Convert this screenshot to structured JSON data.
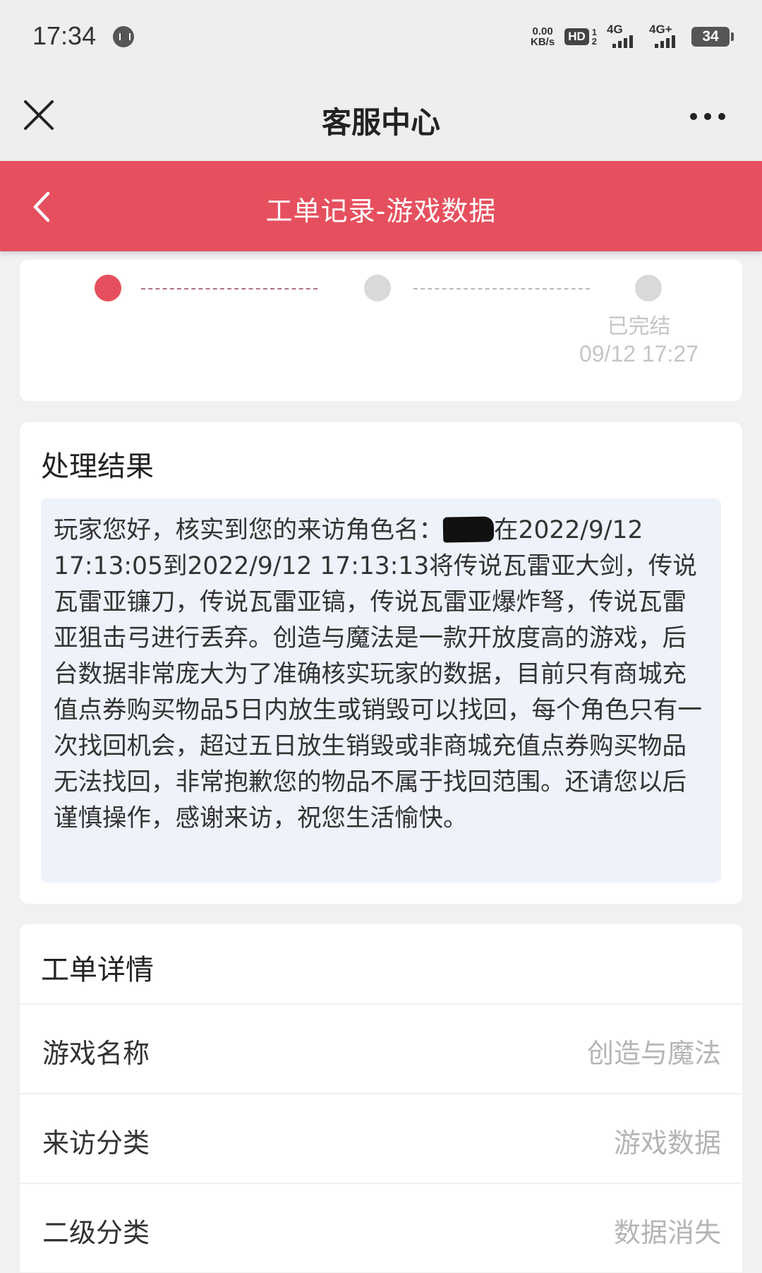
{
  "status_bar": {
    "time": "17:34",
    "net_speed_value": "0.00",
    "net_speed_unit": "KB/s",
    "hd_label": "HD",
    "hd_sub_top": "1",
    "hd_sub_bottom": "2",
    "signal1_label": "4G",
    "signal2_label": "4G+",
    "battery_level": "34"
  },
  "title_bar": {
    "title": "客服中心"
  },
  "header": {
    "title": "工单记录-游戏数据"
  },
  "progress": {
    "steps": [
      {
        "state": "active"
      },
      {
        "state": "idle"
      },
      {
        "state": "idle",
        "label": "已完结",
        "time": "09/12 17:27"
      }
    ]
  },
  "result": {
    "title": "处理结果",
    "text_before_redaction": "玩家您好，核实到您的来访角色名：",
    "text_after_redaction": "在2022/9/12 17:13:05到2022/9/12 17:13:13将传说瓦雷亚大剑，传说瓦雷亚镰刀，传说瓦雷亚镐，传说瓦雷亚爆炸弩，传说瓦雷亚狙击弓进行丢弃。创造与魔法是一款开放度高的游戏，后台数据非常庞大为了准确核实玩家的数据，目前只有商城充值点券购买物品5日内放生或销毁可以找回，每个角色只有一次找回机会，超过五日放生销毁或非商城充值点券购买物品无法找回，非常抱歉您的物品不属于找回范围。还请您以后谨慎操作，感谢来访，祝您生活愉快。"
  },
  "details": {
    "title": "工单详情",
    "rows": [
      {
        "label": "游戏名称",
        "value": "创造与魔法"
      },
      {
        "label": "来访分类",
        "value": "游戏数据"
      },
      {
        "label": "二级分类",
        "value": "数据消失"
      }
    ]
  },
  "colors": {
    "accent": "#e6505e",
    "card_background": "#ffffff",
    "page_background": "#f1f1f3",
    "result_box": "#eef2fa"
  }
}
